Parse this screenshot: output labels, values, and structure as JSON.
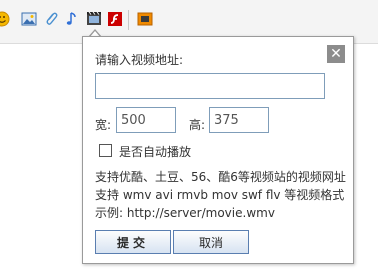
{
  "toolbar": {
    "icons": [
      "smiley-icon",
      "image-icon",
      "attachment-icon",
      "music-icon",
      "video-icon",
      "flash-icon",
      "media-icon"
    ],
    "colors": {
      "smiley": "#f5b800",
      "image": "#3a6fb0",
      "attach": "#4a90d0",
      "music": "#2f6fd6",
      "video": "#333333",
      "flash": "#cc0000",
      "media": "#f08a00"
    }
  },
  "dialog": {
    "url_label": "请输入视频地址:",
    "url_value": "",
    "width_label": "宽:",
    "width_value": "500",
    "height_label": "高:",
    "height_value": "375",
    "autoplay_label": "是否自动播放",
    "autoplay_checked": false,
    "help_line1": "支持优酷、土豆、56、酷6等视频站的视频网址",
    "help_line2": "支持 wmv avi rmvb mov swf flv 等视频格式",
    "help_line3": "示例: http://server/movie.wmv",
    "submit_label": "提交",
    "cancel_label": "取消",
    "close_symbol": "✕"
  }
}
